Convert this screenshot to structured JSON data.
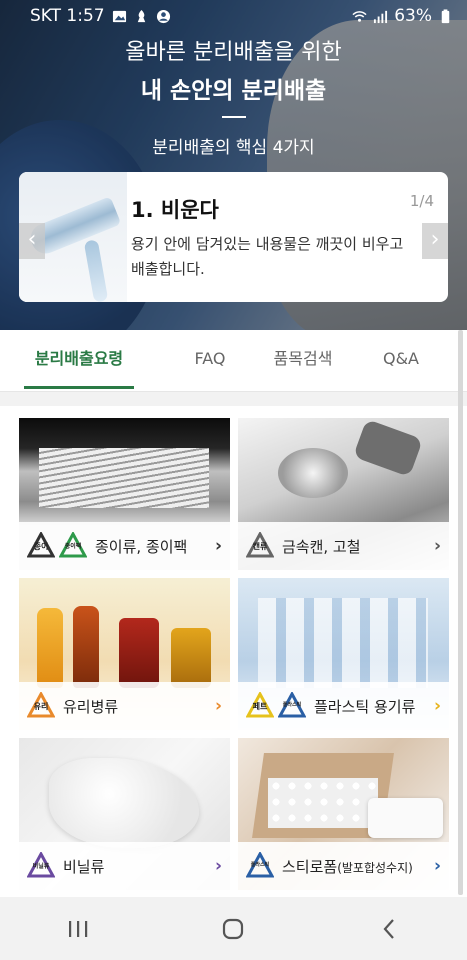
{
  "status_bar": {
    "carrier_time": "SKT 1:57",
    "battery": "63%"
  },
  "hero": {
    "line1": "올바른 분리배출을 위한",
    "line2": "내 손안의 분리배출",
    "subtitle": "분리배출의 핵심 4가지"
  },
  "slider": {
    "title": "1. 비운다",
    "page": "1/4",
    "description": "용기 안에 담겨있는 내용물은 깨끗이 비우고 배출합니다."
  },
  "tabs": [
    {
      "label": "분리배출요령"
    },
    {
      "label": "FAQ"
    },
    {
      "label": "품목검색"
    },
    {
      "label": "Q&A"
    }
  ],
  "categories": [
    {
      "label": "종이류, 종이팩",
      "icon1_text": "종이",
      "icon2_text": "종이팩",
      "icon1_color": "#333333",
      "icon2_color": "#2e9a4a",
      "chev_color": "#333333"
    },
    {
      "label": "금속캔, 고철",
      "icon1_text": "캔류",
      "icon1_color": "#666666",
      "chev_color": "#555555"
    },
    {
      "label": "유리병류",
      "icon1_text": "유리",
      "icon1_color": "#e98a2b",
      "chev_color": "#e98a2b"
    },
    {
      "label": "플라스틱 용기류",
      "icon1_text": "페트",
      "icon2_text": "플라스틱",
      "icon1_color": "#e6c21c",
      "icon2_color": "#2a5fa5",
      "chev_color": "#e6b31c"
    },
    {
      "label": "비닐류",
      "icon1_text": "비닐류",
      "icon1_color": "#6a4aa0",
      "chev_color": "#6a4aa0"
    },
    {
      "label": "스티로폼",
      "label_suffix": "(발포합성수지)",
      "icon1_text": "플라스틱",
      "icon1_color": "#2a5fa5",
      "chev_color": "#2a5fa5"
    }
  ],
  "colors": {
    "accent_green": "#2a7a45"
  }
}
